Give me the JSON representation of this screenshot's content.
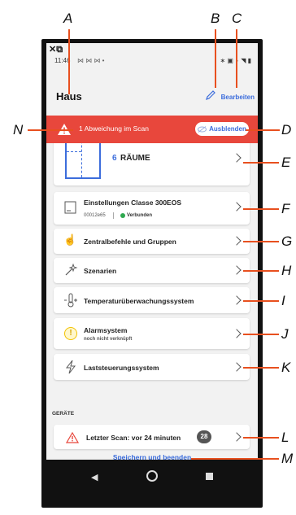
{
  "callouts": {
    "a": "A",
    "b": "B",
    "c": "C",
    "d": "D",
    "e": "E",
    "f": "F",
    "g": "G",
    "h": "H",
    "i": "I",
    "j": "J",
    "k": "K",
    "l": "L",
    "m": "M",
    "n": "N"
  },
  "statusbar": {
    "time": "11:46",
    "icons_left": "⋈ ⋈ ⋈ •",
    "icons_right": "∗ ▣ ◗ ◥ ▮"
  },
  "header": {
    "title": "Haus",
    "edit_label": "Bearbeiten"
  },
  "banner": {
    "text": "1 Abweichung im Scan",
    "hide_label": "Ausblenden"
  },
  "rooms": {
    "count": "6",
    "label": "RÄUME"
  },
  "items": [
    {
      "label": "Einstellungen Classe 300EOS",
      "sub_id": "00012e65",
      "sub_status": "Verbunden"
    },
    {
      "label": "Zentralbefehle und Gruppen"
    },
    {
      "label": "Szenarien"
    },
    {
      "label": "Temperaturüberwachungssystem"
    },
    {
      "label": "Alarmsystem",
      "sub": "noch nicht verknüpft"
    },
    {
      "label": "Laststeuerungssystem"
    }
  ],
  "devices": {
    "section_label": "GERÄTE",
    "scan_label": "Letzter Scan: vor 24 minuten",
    "count": "28"
  },
  "save_label": "Speichern und beenden",
  "colors": {
    "accent": "#3c6ddc",
    "banner": "#e8473c",
    "status_ok": "#2fa84f",
    "leader": "#e8501f",
    "warning": "#f2c200"
  }
}
